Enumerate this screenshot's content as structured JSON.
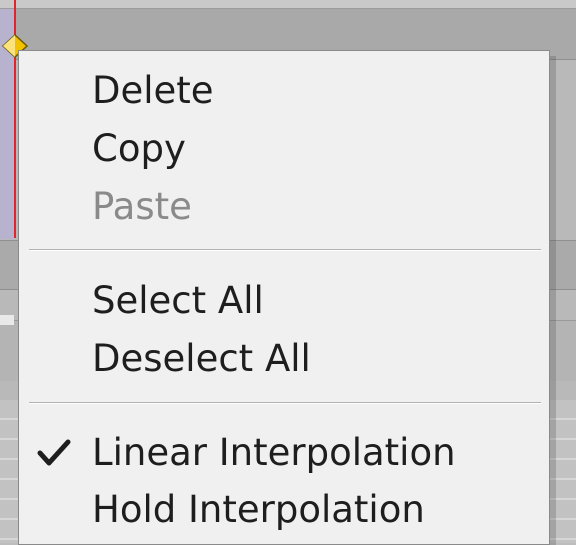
{
  "context_menu": {
    "items": [
      {
        "label": "Delete",
        "enabled": true,
        "checked": false
      },
      {
        "label": "Copy",
        "enabled": true,
        "checked": false
      },
      {
        "label": "Paste",
        "enabled": false,
        "checked": false
      },
      {
        "label": "Select All",
        "enabled": true,
        "checked": false
      },
      {
        "label": "Deselect All",
        "enabled": true,
        "checked": false
      },
      {
        "label": "Linear Interpolation",
        "enabled": true,
        "checked": true
      },
      {
        "label": "Hold Interpolation",
        "enabled": true,
        "checked": false
      }
    ]
  },
  "colors": {
    "playhead": "#e0242b",
    "keyframe": "#f2c200",
    "menu_background": "#f0f0f0",
    "disabled_text": "#8a8a8a"
  },
  "icons": {
    "checked_item": "check-icon",
    "timeline_marker": "keyframe-icon"
  }
}
